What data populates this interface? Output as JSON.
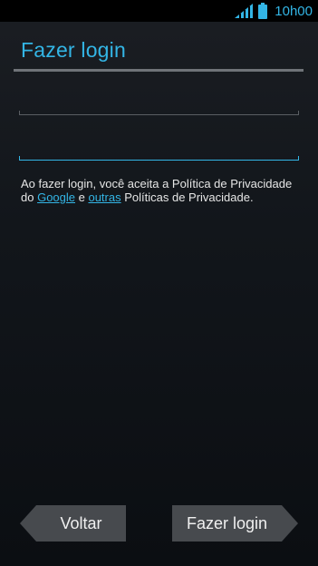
{
  "status_bar": {
    "time": "10h00",
    "icons": [
      "signal-icon",
      "battery-icon"
    ],
    "accent_color": "#33b5e5"
  },
  "header": {
    "title": "Fazer login"
  },
  "form": {
    "email": {
      "value": "",
      "placeholder": ""
    },
    "password": {
      "value": "",
      "placeholder": ""
    }
  },
  "policy": {
    "prefix": " Ao fazer login, você aceita a Política de Privacidade do ",
    "link_google": "Google",
    "middle": " e ",
    "link_others": "outras",
    "suffix": " Políticas de Privacidade."
  },
  "buttons": {
    "back_label": "Voltar",
    "login_label": "Fazer login"
  },
  "colors": {
    "accent": "#33b5e5",
    "button_bg": "#474a4e"
  }
}
